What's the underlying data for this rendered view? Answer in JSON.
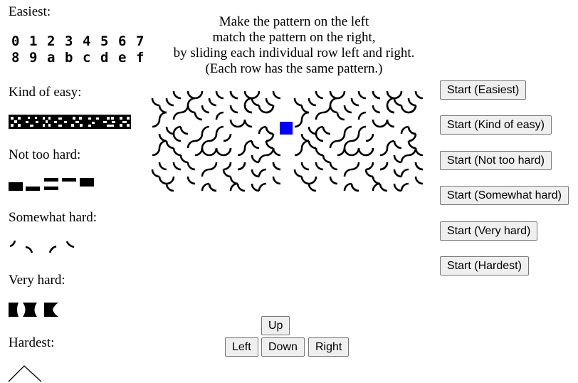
{
  "levels": [
    {
      "label": "Easiest:",
      "preview_glyphs": [
        [
          "0",
          "1",
          "2",
          "3",
          "4",
          "5",
          "6",
          "7"
        ],
        [
          "8",
          "9",
          "a",
          "b",
          "c",
          "d",
          "e",
          "f"
        ]
      ]
    },
    {
      "label": "Kind of easy:"
    },
    {
      "label": "Not too hard:"
    },
    {
      "label": "Somewhat hard:"
    },
    {
      "label": "Very hard:"
    },
    {
      "label": "Hardest:"
    }
  ],
  "instructions": [
    "Make the pattern on the left",
    "match the pattern on the right,",
    "by sliding each individual row left and right.",
    "(Each row has the same pattern.)"
  ],
  "start_buttons": [
    "Start (Easiest)",
    "Start (Kind of easy)",
    "Start (Not too hard)",
    "Start (Somewhat hard)",
    "Start (Very hard)",
    "Start (Hardest)"
  ],
  "controls": {
    "up": "Up",
    "left": "Left",
    "down": "Down",
    "right": "Right"
  },
  "colors": {
    "cursor": "#0000ff",
    "ink": "#000000",
    "button_bg": "#efefef",
    "button_border": "#767676"
  }
}
